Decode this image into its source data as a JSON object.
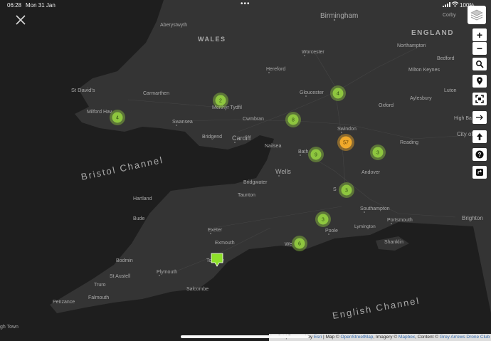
{
  "status_bar": {
    "time": "06:28",
    "date": "Mon 31 Jan",
    "battery_pct": "100%"
  },
  "map": {
    "sea_labels": [
      {
        "id": "bristol-channel",
        "text": "Bristol Channel"
      },
      {
        "id": "english-channel",
        "text": "English Channel"
      }
    ],
    "country_labels": [
      {
        "id": "wales",
        "text": "WALES"
      },
      {
        "id": "england",
        "text": "ENGLAND"
      }
    ],
    "city_labels": [
      {
        "id": "birmingham",
        "text": "Birmingham"
      },
      {
        "id": "corby",
        "text": "Corby"
      },
      {
        "id": "aberystwyth",
        "text": "Aberystwyth"
      },
      {
        "id": "worcester",
        "text": "Worcester"
      },
      {
        "id": "northampton",
        "text": "Northampton"
      },
      {
        "id": "bedford",
        "text": "Bedford"
      },
      {
        "id": "milton-keynes",
        "text": "Milton Keynes"
      },
      {
        "id": "hereford",
        "text": "Hereford"
      },
      {
        "id": "st-davids",
        "text": "St David's"
      },
      {
        "id": "carmarthen",
        "text": "Carmarthen"
      },
      {
        "id": "gloucester",
        "text": "Gloucester"
      },
      {
        "id": "luton",
        "text": "Luton"
      },
      {
        "id": "aylesbury",
        "text": "Aylesbury"
      },
      {
        "id": "milford-haven",
        "text": "Milford Hav"
      },
      {
        "id": "merthyr-tydfil",
        "text": "Merthyr Tydfil"
      },
      {
        "id": "oxford",
        "text": "Oxford"
      },
      {
        "id": "swansea",
        "text": "Swansea"
      },
      {
        "id": "cwmbran",
        "text": "Cwmbran"
      },
      {
        "id": "high-wycombe",
        "text": "High Ba"
      },
      {
        "id": "bridgend",
        "text": "Bridgend"
      },
      {
        "id": "cardiff",
        "text": "Cardiff"
      },
      {
        "id": "swindon",
        "text": "Swindon"
      },
      {
        "id": "city-of-london",
        "text": "City of Lo"
      },
      {
        "id": "nailsea",
        "text": "Nailsea"
      },
      {
        "id": "bath",
        "text": "Bath"
      },
      {
        "id": "reading",
        "text": "Reading"
      },
      {
        "id": "wells",
        "text": "Wells"
      },
      {
        "id": "andover",
        "text": "Andover"
      },
      {
        "id": "bridgwater",
        "text": "Bridgwater"
      },
      {
        "id": "hartland",
        "text": "Hartland"
      },
      {
        "id": "taunton",
        "text": "Taunton"
      },
      {
        "id": "salisbury",
        "text": "S"
      },
      {
        "id": "southampton",
        "text": "Southampton"
      },
      {
        "id": "bude",
        "text": "Bude"
      },
      {
        "id": "brighton",
        "text": "Brighton"
      },
      {
        "id": "portsmouth",
        "text": "Portsmouth"
      },
      {
        "id": "exeter",
        "text": "Exeter"
      },
      {
        "id": "poole",
        "text": "Poole"
      },
      {
        "id": "lymington",
        "text": "Lymington"
      },
      {
        "id": "exmouth",
        "text": "Exmouth"
      },
      {
        "id": "shanklin",
        "text": "Shanklin"
      },
      {
        "id": "weymouth",
        "text": "We"
      },
      {
        "id": "bodmin",
        "text": "Bodmin"
      },
      {
        "id": "torquay",
        "text": "Torquay"
      },
      {
        "id": "st-austell",
        "text": "St Austell"
      },
      {
        "id": "plymouth",
        "text": "Plymouth"
      },
      {
        "id": "truro",
        "text": "Truro"
      },
      {
        "id": "falmouth",
        "text": "Falmouth"
      },
      {
        "id": "salcombe",
        "text": "Salcombe"
      },
      {
        "id": "penzance",
        "text": "Penzance"
      },
      {
        "id": "st-just",
        "text": "gh Town"
      }
    ],
    "clusters": [
      {
        "id": "milford",
        "count": "4",
        "color": "#8ec63f"
      },
      {
        "id": "merthyr",
        "count": "2",
        "color": "#8ec63f"
      },
      {
        "id": "gloucester",
        "count": "4",
        "color": "#8ec63f"
      },
      {
        "id": "stroud",
        "count": "8",
        "color": "#8ec63f"
      },
      {
        "id": "swindon",
        "count": "57",
        "color": "#f0a92b"
      },
      {
        "id": "bath",
        "count": "9",
        "color": "#8ec63f"
      },
      {
        "id": "newbury",
        "count": "3",
        "color": "#8ec63f"
      },
      {
        "id": "salisbury",
        "count": "3",
        "color": "#8ec63f"
      },
      {
        "id": "bournemouth",
        "count": "3",
        "color": "#8ec63f"
      },
      {
        "id": "weymouth",
        "count": "6",
        "color": "#8ec63f"
      }
    ],
    "marker_color": "#8ee02a"
  },
  "controls": {
    "close": "close-icon",
    "layers": "layers-icon",
    "zoom_in": "+",
    "zoom_out": "−",
    "search": "search-icon",
    "locate": "location-pin-icon",
    "fullscreen": "fullscreen-icon",
    "pan": "arrow-right-icon",
    "north": "arrow-up-icon",
    "help": "help-icon",
    "share": "share-icon"
  },
  "attribution": {
    "prefix": "Leaflet | Powered by",
    "esri": "Esri",
    "map_label": "| Map ©",
    "osm": "OpenStreetMap",
    "imagery_label": ", Imagery ©",
    "mapbox": "Mapbox",
    "content_label": ", Content ©",
    "club": "Grey Arrows Drone Club"
  }
}
